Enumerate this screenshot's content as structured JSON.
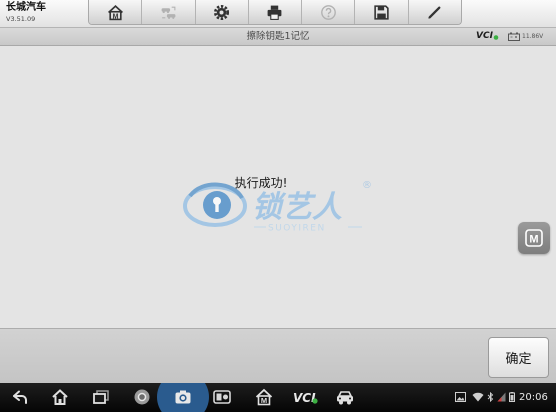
{
  "app": {
    "title": "长城汽车",
    "version": "V3.51.09"
  },
  "toolbar": {
    "buttons": [
      {
        "icon": "home-m-icon",
        "label_letter": "M",
        "enabled": true
      },
      {
        "icon": "vehicle-swap-icon",
        "enabled": false
      },
      {
        "icon": "gear-icon",
        "enabled": true
      },
      {
        "icon": "printer-icon",
        "enabled": true
      },
      {
        "icon": "help-icon",
        "enabled": false
      },
      {
        "icon": "save-icon",
        "enabled": true
      },
      {
        "icon": "pen-icon",
        "enabled": true
      }
    ]
  },
  "subheader": {
    "title": "擦除钥匙1记忆",
    "vci_label": "VCI",
    "voltage": "11.86V"
  },
  "main": {
    "message": "执行成功!"
  },
  "watermark": {
    "brand": "锁艺人",
    "registered": "®",
    "latin": "SUOYIREN"
  },
  "side_button": {
    "letter": "M"
  },
  "footer": {
    "confirm_label": "确定"
  },
  "navbar": {
    "icons": [
      "back-icon",
      "home-icon",
      "recent-apps-icon",
      "browser-icon",
      "camera-icon",
      "screen-tool-icon",
      "home-m-icon",
      "vci-icon",
      "car-icon"
    ],
    "m_letter": "M",
    "vci_label": "VCI",
    "status_icons": [
      "image-icon",
      "wifi-icon",
      "bluetooth-icon",
      "signal-icon",
      "battery-icon"
    ],
    "time": "20:06"
  },
  "colors": {
    "accent_blue": "#2a5b8e",
    "vci_green": "#3cb043",
    "watermark_blue": "#5f9fd6"
  }
}
